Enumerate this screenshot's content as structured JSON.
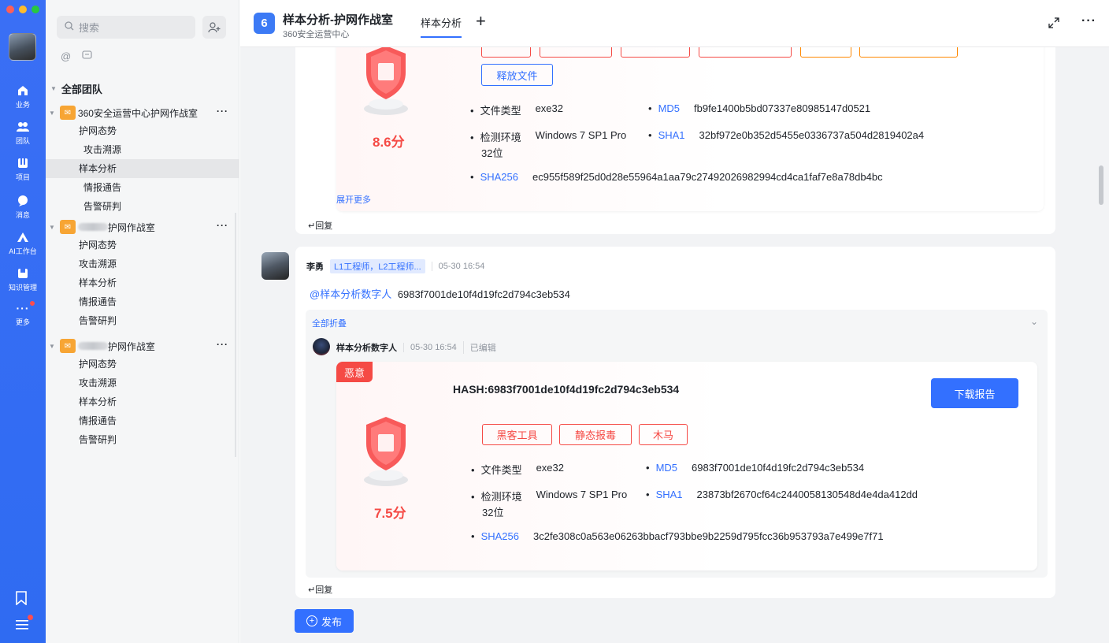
{
  "rail": {
    "items": [
      {
        "label": "业务",
        "icon": "home-icon"
      },
      {
        "label": "团队",
        "icon": "team-icon"
      },
      {
        "label": "项目",
        "icon": "project-icon"
      },
      {
        "label": "消息",
        "icon": "message-icon"
      },
      {
        "label": "AI工作台",
        "icon": "ai-icon"
      },
      {
        "label": "知识管理",
        "icon": "knowledge-icon"
      },
      {
        "label": "更多",
        "icon": "more-icon"
      }
    ]
  },
  "sidebar": {
    "search_placeholder": "搜索",
    "all_teams": "全部团队",
    "teams": [
      {
        "name": "360安全运营中心护网作战室",
        "items": [
          "护网态势",
          "攻击溯源",
          "样本分析",
          "情报通告",
          "告警研判"
        ],
        "active": "样本分析"
      },
      {
        "name": "护网作战室",
        "items": [
          "护网态势",
          "攻击溯源",
          "样本分析",
          "情报通告",
          "告警研判"
        ]
      },
      {
        "name": "护网作战室",
        "items": [
          "护网态势",
          "攻击溯源",
          "样本分析",
          "情报通告",
          "告警研判"
        ]
      }
    ]
  },
  "header": {
    "channel_icon": "6",
    "title": "样本分析-护网作战室",
    "subtitle": "360安全运营中心",
    "tab": "样本分析",
    "tab_add": "+"
  },
  "report1": {
    "release_tag": "释放文件",
    "score": "8.6分",
    "file_type_label": "文件类型",
    "file_type": "exe32",
    "env_label": "检测环境",
    "env": "Windows 7 SP1 Pro",
    "env_cont": "32位",
    "md5_label": "MD5",
    "md5": "fb9fe1400b5bd07337e80985147d0521",
    "sha1_label": "SHA1",
    "sha1": "32bf972e0b352d5455e0336737a504d2819402a4",
    "sha256_label": "SHA256",
    "sha256": "ec955f589f25d0d28e55964a1aa79c27492026982994cd4ca1faf7e8a78db4bc",
    "expand_more": "展开更多",
    "reply": "回复"
  },
  "message": {
    "author": "李勇",
    "role": "L1工程师，L2工程师...",
    "time": "05-30 16:54",
    "mention": "@样本分析数字人",
    "hash_text": "6983f7001de10f4d19fc2d794c3eb534",
    "collapse_all": "全部折叠",
    "bot_name": "样本分析数字人",
    "bot_time": "05-30 16:54",
    "bot_edited": "已编辑",
    "reply": "回复"
  },
  "report2": {
    "badge": "恶意",
    "hash_title": "HASH:6983f7001de10f4d19fc2d794c3eb534",
    "download": "下载报告",
    "tags": [
      "黑客工具",
      "静态报毒",
      "木马"
    ],
    "score": "7.5分",
    "file_type_label": "文件类型",
    "file_type": "exe32",
    "env_label": "检测环境",
    "env": "Windows 7 SP1 Pro",
    "env_cont": "32位",
    "md5_label": "MD5",
    "md5": "6983f7001de10f4d19fc2d794c3eb534",
    "sha1_label": "SHA1",
    "sha1": "23873bf2670cf64c2440058130548d4e4da412dd",
    "sha256_label": "SHA256",
    "sha256": "3c2fe308c0a563e06263bbacf793bbe9b2259d795fcc36b953793a7e499e7f71"
  },
  "composer": {
    "publish": "发布"
  },
  "colors": {
    "accent": "#3370ff",
    "danger": "#f54a45",
    "warning": "#ff8800",
    "team_logo": "#f7a534"
  }
}
